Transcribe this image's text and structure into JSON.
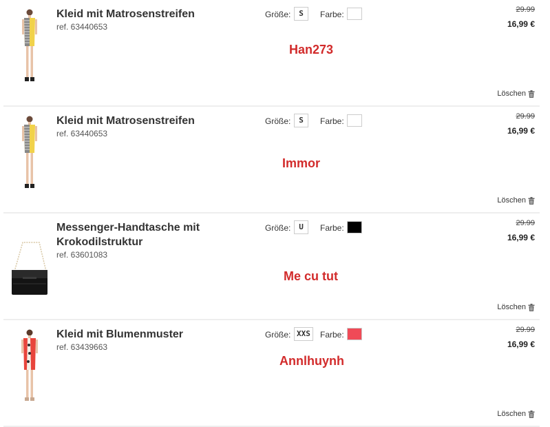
{
  "items": [
    {
      "name": "Kleid mit Matrosenstreifen",
      "ref": "ref. 63440653",
      "size_label": "Größe:",
      "size": "S",
      "color_label": "Farbe:",
      "color": "#ffffff",
      "overlay": "Han273",
      "price_old": "29.99",
      "price_new": "16,99 €",
      "delete_label": "Löschen",
      "image_icon": "striped-dress-image"
    },
    {
      "name": "Kleid mit Matrosenstreifen",
      "ref": "ref. 63440653",
      "size_label": "Größe:",
      "size": "S",
      "color_label": "Farbe:",
      "color": "#ffffff",
      "overlay": "Immor",
      "price_old": "29.99",
      "price_new": "16,99 €",
      "delete_label": "Löschen",
      "image_icon": "striped-dress-image"
    },
    {
      "name": "Messenger-Handtasche mit Krokodilstruktur",
      "ref": "ref. 63601083",
      "size_label": "Größe:",
      "size": "U",
      "color_label": "Farbe:",
      "color": "#000000",
      "overlay": "Me cu tut",
      "price_old": "29.99",
      "price_new": "16,99 €",
      "delete_label": "Löschen",
      "image_icon": "handbag-image"
    },
    {
      "name": "Kleid mit Blumenmuster",
      "ref": "ref. 63439663",
      "size_label": "Größe:",
      "size": "XXS",
      "color_label": "Farbe:",
      "color": "#f04a57",
      "overlay": "Annlhuynh",
      "price_old": "29.99",
      "price_new": "16,99 €",
      "delete_label": "Löschen",
      "image_icon": "floral-dress-image"
    }
  ],
  "accent_color": "#d22b2b"
}
